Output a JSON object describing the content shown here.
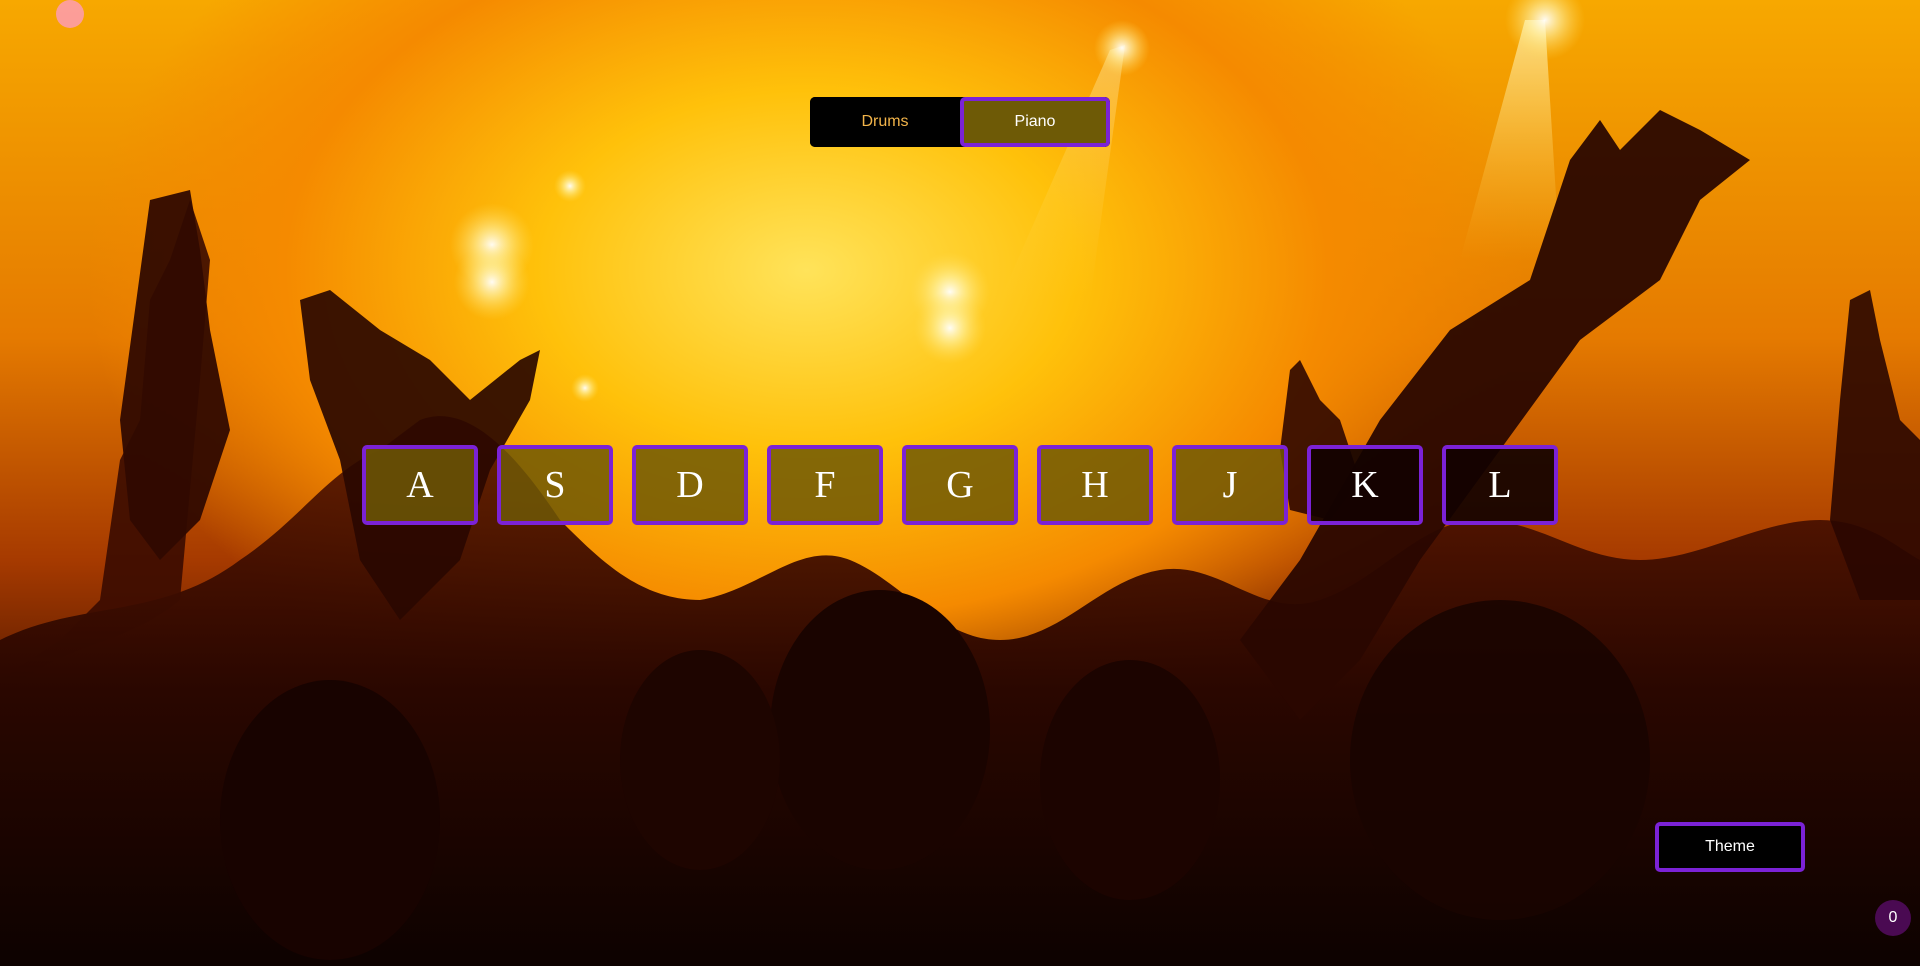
{
  "mode_switch": {
    "drums_label": "Drums",
    "piano_label": "Piano",
    "active": "Piano"
  },
  "keys": [
    {
      "label": "A",
      "active": true
    },
    {
      "label": "S",
      "active": true
    },
    {
      "label": "D",
      "active": true
    },
    {
      "label": "F",
      "active": true
    },
    {
      "label": "G",
      "active": true
    },
    {
      "label": "H",
      "active": true
    },
    {
      "label": "J",
      "active": true
    },
    {
      "label": "K",
      "active": false
    },
    {
      "label": "L",
      "active": false
    }
  ],
  "theme_button": {
    "label": "Theme"
  },
  "counter": {
    "value": "0"
  },
  "colors": {
    "accent_border": "#7b22d6",
    "active_key_fill": "#6e5a06",
    "drums_text": "#f2b44a",
    "counter_bg": "#4a0a52"
  },
  "background": {
    "description_icon": "concert-crowd-image"
  }
}
